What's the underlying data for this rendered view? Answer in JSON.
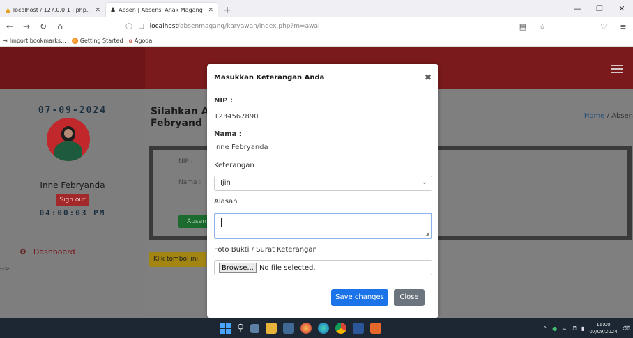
{
  "browser": {
    "tabs": [
      {
        "title": "localhost / 127.0.0.1 | phpMyAdmin",
        "active": false
      },
      {
        "title": "Absen | Absensi Anak Magang",
        "active": true
      }
    ],
    "url_host": "localhost",
    "url_path": "/absenmagang/karyawan/index.php?m=awal",
    "bookmarks": [
      "Import bookmarks...",
      "Getting Started",
      "Agoda"
    ]
  },
  "sidebar": {
    "date": "07-09-2024",
    "user_name": "Inne Febryanda",
    "signout_label": "Sign out",
    "clock": "04:00:03 PM",
    "menu": [
      {
        "label": "Dashboard",
        "icon": "dashboard-icon"
      }
    ],
    "arrow_text": "-->"
  },
  "main": {
    "greeting_line1": "Silahkan A",
    "greeting_line2": "Febryand",
    "breadcrumb_home": "Home",
    "breadcrumb_sep": "/",
    "breadcrumb_current": "Absen",
    "card_nip_label": "NIP :",
    "card_nama_label": "Nama :",
    "absen_label": "Absen",
    "info_text": "Klik tombol ini"
  },
  "modal": {
    "title": "Masukkan Keterangan Anda",
    "nip_label": "NIP :",
    "nip_value": "1234567890",
    "nama_label": "Nama :",
    "nama_value": "Inne Febryanda",
    "keterangan_label": "Keterangan",
    "keterangan_selected": "Ijin",
    "alasan_label": "Alasan",
    "alasan_value": "",
    "foto_label": "Foto Bukti / Surat Keterangan",
    "browse_label": "Browse...",
    "file_status": "No file selected.",
    "save_label": "Save changes",
    "close_label": "Close"
  },
  "taskbar": {
    "time": "16:00",
    "date": "07/09/2024"
  },
  "colors": {
    "brand_dark": "#7a1a1c",
    "primary": "#1a73e8",
    "secondary": "#6c757d",
    "success": "#1b6a2e",
    "warning": "#a38511"
  }
}
